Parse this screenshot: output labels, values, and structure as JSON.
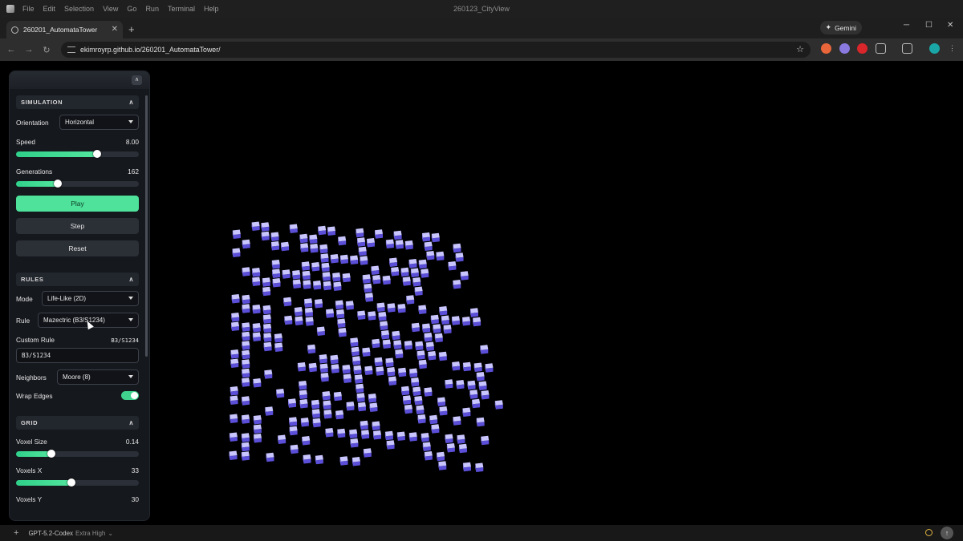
{
  "menubar": {
    "items": [
      "File",
      "Edit",
      "Selection",
      "View",
      "Go",
      "Run",
      "Terminal",
      "Help"
    ],
    "window_title": "260123_CityView"
  },
  "browser": {
    "tab_title": "260201_AutomataTower",
    "gemini_label": "Gemini",
    "url": "ekimroyrp.github.io/260201_AutomataTower/"
  },
  "panel": {
    "simulation": {
      "title": "SIMULATION",
      "orientation_label": "Orientation",
      "orientation_value": "Horizontal",
      "speed_label": "Speed",
      "speed_value": "8.00",
      "speed_level": 0.66,
      "generations_label": "Generations",
      "generations_value": "162",
      "generations_level": 0.34,
      "play_label": "Play",
      "step_label": "Step",
      "reset_label": "Reset"
    },
    "rules": {
      "title": "RULES",
      "mode_label": "Mode",
      "mode_value": "Life-Like (2D)",
      "rule_label": "Rule",
      "rule_value": "Mazectric (B3/S1234)",
      "custom_rule_label": "Custom Rule",
      "custom_rule_display": "B3/S1234",
      "custom_rule_input": "B3/S1234",
      "neighbors_label": "Neighbors",
      "neighbors_value": "Moore (8)",
      "wrap_label": "Wrap Edges",
      "wrap_on": true
    },
    "grid": {
      "title": "GRID",
      "voxel_size_label": "Voxel Size",
      "voxel_size_value": "0.14",
      "voxel_size_level": 0.29,
      "voxels_x_label": "Voxels X",
      "voxels_x_value": "33",
      "voxels_x_level": 0.45,
      "voxels_y_label": "Voxels Y",
      "voxels_y_value": "30"
    }
  },
  "statusbar": {
    "model": "GPT-5.2-Codex",
    "effort": "Extra High"
  },
  "colors": {
    "accent_green": "#4ee29b",
    "voxel_top": "#c9c6ff",
    "voxel_left": "#7e74f2",
    "voxel_right": "#5b4fd9"
  }
}
